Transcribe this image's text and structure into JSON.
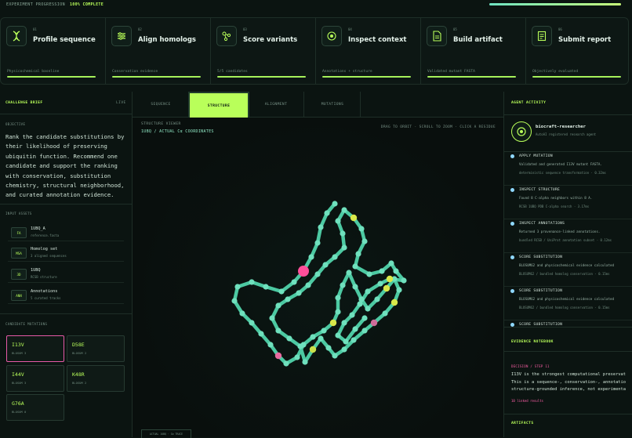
{
  "topbar": {
    "label": "EXPERIMENT PROGRESSION",
    "percent": "100% COMPLETE",
    "progress": 1.0
  },
  "steps": [
    {
      "num": "01",
      "title": "Profile sequence",
      "sub": "Physicochemical baseline",
      "icon": "dna-icon"
    },
    {
      "num": "02",
      "title": "Align homologs",
      "sub": "Conservation evidence",
      "icon": "align-icon"
    },
    {
      "num": "03",
      "title": "Score variants",
      "sub": "5/5 candidates",
      "icon": "molecule-icon"
    },
    {
      "num": "04",
      "title": "Inspect context",
      "sub": "Annotations + structure",
      "icon": "eye-icon"
    },
    {
      "num": "05",
      "title": "Build artifact",
      "sub": "Validated mutant FASTA",
      "icon": "document-icon"
    },
    {
      "num": "06",
      "title": "Submit report",
      "sub": "Objectively evaluated",
      "icon": "report-icon"
    }
  ],
  "left": {
    "title": "CHALLENGE BRIEF",
    "live": "LIVE",
    "objective_label": "OBJECTIVE",
    "objective": "Rank the candidate substitutions by their likelihood of preserving ubiquitin function. Recommend one candidate and support the ranking with conservation, substitution chemistry, structural neighborhood, and curated annotation evidence.",
    "assets_label": "INPUT ASSETS",
    "assets": [
      {
        "tag": "FA",
        "name": "1UBQ_A",
        "desc": "reference.fasta"
      },
      {
        "tag": "MSA",
        "name": "Homolog set",
        "desc": "3 aligned sequences"
      },
      {
        "tag": "3D",
        "name": "1UBQ",
        "desc": "RCSB structure"
      },
      {
        "tag": "ANN",
        "name": "Annotations",
        "desc": "5 curated tracks"
      }
    ],
    "mutations_label": "CANDIDATE MUTATIONS",
    "mutations": [
      {
        "name": "I13V",
        "blosum": "BLOSUM 3"
      },
      {
        "name": "D58E",
        "blosum": "BLOSUM 2"
      },
      {
        "name": "I44V",
        "blosum": "BLOSUM 3"
      },
      {
        "name": "K48R",
        "blosum": "BLOSUM 2"
      },
      {
        "name": "G76A",
        "blosum": "BLOSUM 0"
      }
    ]
  },
  "tabs": [
    "SEQUENCE",
    "STRUCTURE",
    "ALIGNMENT",
    "MUTATIONS"
  ],
  "viewer": {
    "title": "STRUCTURE VIEWER",
    "subtitle": "1UBQ / ACTUAL Cα COORDINATES",
    "hint": "DRAG TO ORBIT · SCROLL TO ZOOM · CLICK A RESIDUE",
    "footer": "ACTUAL 1UBQ · Cα TRACE"
  },
  "right": {
    "title": "AGENT ACTIVITY",
    "agent_name": "biocraft-researcher",
    "agent_desc": "AutoAI registered research agent",
    "events": [
      {
        "title": "APPLY MUTATION",
        "desc": "Validated and generated I13V mutant FASTA.",
        "meta": "deterministic sequence transformation · 0.32ms"
      },
      {
        "title": "INSPECT STRUCTURE",
        "desc": "Found 8 C-alpha neighbors within 8 A.",
        "meta": "RCSB 1UBQ PDB C-alpha search · 3.17ms"
      },
      {
        "title": "INSPECT ANNOTATIONS",
        "desc": "Returned 3 provenance-linked annotations.",
        "meta": "bundled RCSB / UniProt annotation subset · 0.12ms"
      },
      {
        "title": "SCORE SUBSTITUTION",
        "desc": "BLOSUM62 and physicochemical evidence calculated",
        "meta": "BLOSUM62 / bundled homolog conservation · 0.15ms"
      },
      {
        "title": "SCORE SUBSTITUTION",
        "desc": "BLOSUM62 and physicochemical evidence calculated",
        "meta": "BLOSUM62 / bundled homolog conservation · 0.15ms"
      },
      {
        "title": "SCORE SUBSTITUTION",
        "desc": "",
        "meta": ""
      }
    ],
    "notebook_title": "EVIDENCE NOTEBOOK",
    "decision_label": "DECISION / STEP 11",
    "decision_lines": [
      "I13V is the strongest computational preservat",
      "This is a sequence-, conservation-, annotatio",
      "structure-grounded inference, not experimenta"
    ],
    "linked": "10 linked results",
    "artifacts_title": "ARTIFACTS"
  },
  "colors": {
    "accent": "#b9ff5a",
    "backbone": "#57d6b0",
    "highlight": "#ff4f9a",
    "ligand": "#d8e84a"
  }
}
